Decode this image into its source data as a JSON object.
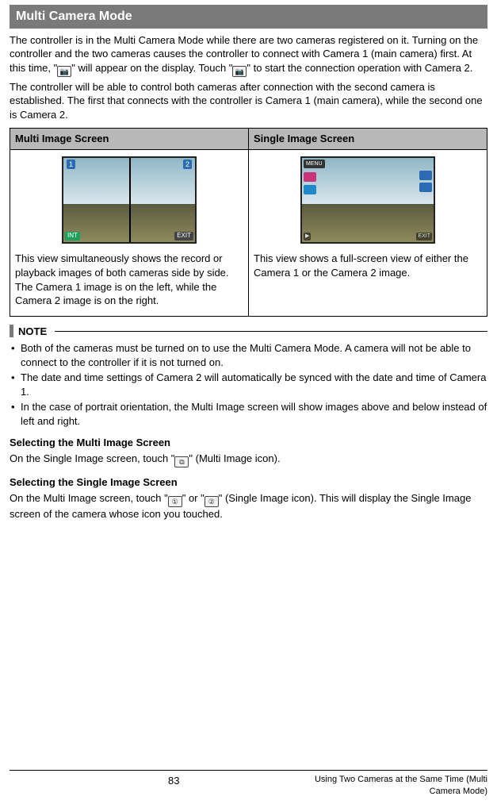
{
  "header": {
    "title": "Multi Camera Mode"
  },
  "intro": {
    "p1a": "The controller is in the Multi Camera Mode while there are two cameras registered on it. Turning on the controller and the two cameras causes the controller to connect with Camera 1 (main camera) first. At this time, \"",
    "p1b": "\" will appear on the display. Touch \"",
    "p1c": "\" to start the connection operation with Camera 2.",
    "p2": "The controller will be able to control both cameras after connection with the second camera is established. The first that connects with the controller is Camera 1 (main camera), while the second one is Camera 2."
  },
  "table": {
    "head1": "Multi Image Screen",
    "head2": "Single Image Screen",
    "cell1a": "This view simultaneously shows the record or playback images of both cameras side by side.",
    "cell1b": "The Camera 1 image is on the left, while the Camera 2 image is on the right.",
    "cell2": "This view shows a full-screen view of either the Camera 1 or the Camera 2 image."
  },
  "note": {
    "label": "NOTE",
    "items": [
      "Both of the cameras must be turned on to use the Multi Camera Mode. A camera will not be able to connect to the controller if it is not turned on.",
      "The date and time settings of Camera 2 will automatically be synced with the date and time of Camera 1.",
      "In the case of portrait orientation, the Multi Image screen will show images above and below instead of left and right."
    ]
  },
  "sub1": {
    "title": "Selecting the Multi Image Screen",
    "body_a": "On the Single Image screen, touch \"",
    "body_b": "\" (Multi Image icon)."
  },
  "sub2": {
    "title": "Selecting the Single Image Screen",
    "body_a": "On the Multi Image screen, touch \"",
    "body_b": "\" or \"",
    "body_c": "\" (Single Image icon). This will display the Single Image screen of the camera whose icon you touched."
  },
  "footer": {
    "page": "83",
    "chapter": "Using Two Cameras at the Same Time (Multi Camera Mode)"
  }
}
